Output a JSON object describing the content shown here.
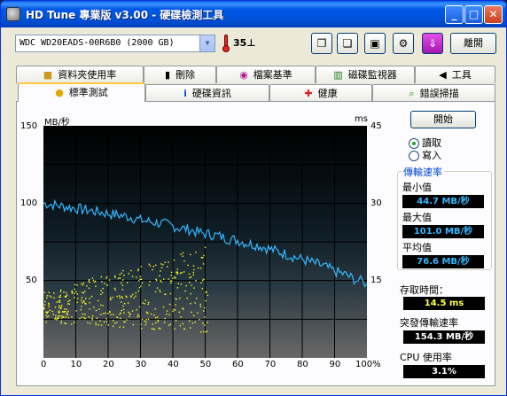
{
  "window": {
    "title": "HD Tune 專業版 v3.00 - 硬碟檢測工具",
    "min_glyph": "_",
    "max_glyph": "□",
    "close_glyph": "✕"
  },
  "toolbar": {
    "drive": "WDC WD20EADS-00R6B0 (2000 GB)",
    "temperature": "35",
    "temperature_unit": "⊥",
    "exit_label": "離開"
  },
  "tabs_top": [
    {
      "label": "資料夾使用率"
    },
    {
      "label": "刪除"
    },
    {
      "label": "檔案基準"
    },
    {
      "label": "磁碟監視器"
    },
    {
      "label": "工具"
    }
  ],
  "tabs_bottom": [
    {
      "label": "標準測試"
    },
    {
      "label": "硬碟資訊"
    },
    {
      "label": "健康"
    },
    {
      "label": "錯誤掃描"
    }
  ],
  "controls": {
    "start_label": "開始",
    "read_label": "讀取",
    "write_label": "寫入",
    "mode_selected": "讀取"
  },
  "stats": {
    "group_title": "傳輸速率",
    "min_label": "最小值",
    "min_value": "44.7 MB/秒",
    "max_label": "最大值",
    "max_value": "101.0 MB/秒",
    "avg_label": "平均值",
    "avg_value": "76.6 MB/秒",
    "access_label": "存取時間：",
    "access_value": "14.5 ms",
    "burst_label": "突發傳輸速率",
    "burst_value": "154.3 MB/秒",
    "cpu_label": "CPU 使用率",
    "cpu_value": "3.1%"
  },
  "colors": {
    "line": "#35b8ff",
    "dots": "#ffff22",
    "grid": "#000000"
  },
  "chart_data": {
    "type": "line",
    "y_left_label": "MB/秒",
    "y_right_label": "ms",
    "y_left_ticks": [
      "150",
      "100",
      "50"
    ],
    "y_right_ticks": [
      "45",
      "30",
      "15"
    ],
    "x_ticks": [
      "0",
      "10",
      "20",
      "30",
      "40",
      "50",
      "60",
      "70",
      "80",
      "90",
      "100%"
    ],
    "ylim_left": [
      0,
      150
    ],
    "ylim_right": [
      0,
      45
    ],
    "xlim": [
      0,
      100
    ],
    "grid": true,
    "series": [
      {
        "type": "line",
        "x": [
          0,
          3,
          6,
          9,
          12,
          15,
          18,
          21,
          24,
          27,
          30,
          33,
          36,
          39,
          42,
          45,
          48,
          51,
          54,
          57,
          60,
          63,
          66,
          69,
          72,
          75,
          78,
          81,
          84,
          87,
          90,
          93,
          96,
          100
        ],
        "values": [
          100,
          99,
          98,
          97,
          96,
          95,
          94,
          93,
          92,
          91,
          89,
          88,
          87,
          86,
          84,
          83,
          81,
          80,
          79,
          77,
          76,
          74,
          73,
          71,
          69,
          67,
          65,
          63,
          61,
          59,
          56,
          54,
          51,
          48
        ]
      },
      {
        "type": "scatter",
        "x_range": [
          0,
          51
        ],
        "y_range_ms": [
          5,
          22
        ]
      }
    ]
  }
}
